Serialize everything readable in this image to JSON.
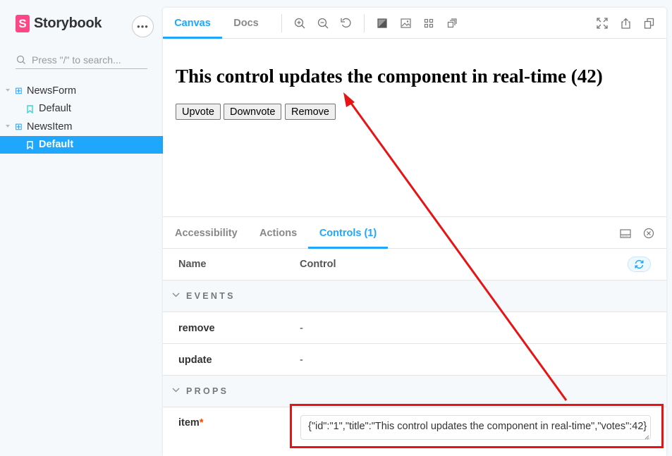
{
  "brand": {
    "name": "Storybook",
    "logo_letter": "S",
    "color": "#ff4785"
  },
  "sidebar": {
    "menu_icon": "ellipsis-icon",
    "search_placeholder": "Press \"/\" to search...",
    "tree": [
      {
        "type": "component",
        "label": "NewsForm"
      },
      {
        "type": "story",
        "label": "Default"
      },
      {
        "type": "component",
        "label": "NewsItem"
      },
      {
        "type": "story",
        "label": "Default",
        "selected": true
      }
    ]
  },
  "toolbar": {
    "tabs": [
      {
        "label": "Canvas",
        "active": true
      },
      {
        "label": "Docs"
      }
    ],
    "tools_left": [
      "zoom-in-icon",
      "zoom-out-icon",
      "reset-zoom-icon",
      "background-icon",
      "image-icon",
      "grid-icon",
      "outline-icon"
    ],
    "tools_right": [
      "fullscreen-icon",
      "share-icon",
      "copy-icon"
    ]
  },
  "preview": {
    "title": "This control updates the component in real-time (42)",
    "buttons": [
      "Upvote",
      "Downvote",
      "Remove"
    ]
  },
  "addons": {
    "tabs": [
      {
        "label": "Accessibility"
      },
      {
        "label": "Actions"
      },
      {
        "label": "Controls (1)",
        "active": true
      }
    ],
    "table": {
      "col_name": "Name",
      "col_control": "Control",
      "sections": [
        {
          "title": "EVENTS",
          "rows": [
            {
              "name": "remove",
              "value": "-"
            },
            {
              "name": "update",
              "value": "-"
            }
          ]
        },
        {
          "title": "PROPS",
          "rows": [
            {
              "name": "item",
              "required": "*",
              "value": "{\"id\":\"1\",\"title\":\"This control updates the component in real-time\",\"votes\":42}"
            }
          ]
        }
      ]
    }
  },
  "colors": {
    "accent": "#1ea7fd",
    "annotation": "#e61414"
  }
}
